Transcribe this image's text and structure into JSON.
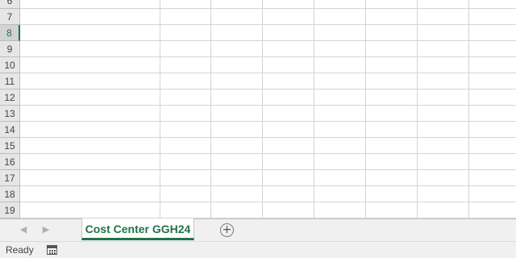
{
  "grid": {
    "rows": [
      {
        "label": "6"
      },
      {
        "label": "7"
      },
      {
        "label": "8",
        "selected": true
      },
      {
        "label": "9"
      },
      {
        "label": "10"
      },
      {
        "label": "11"
      },
      {
        "label": "12"
      },
      {
        "label": "13"
      },
      {
        "label": "14"
      },
      {
        "label": "15"
      },
      {
        "label": "16"
      },
      {
        "label": "17"
      },
      {
        "label": "18"
      },
      {
        "label": "19"
      }
    ]
  },
  "sheet_tabs": {
    "active_tab": "Cost Center GGH24",
    "prev_icon": "chevron-left-icon",
    "next_icon": "chevron-right-icon",
    "add_icon": "plus-circle-icon"
  },
  "status_bar": {
    "status": "Ready",
    "macro_icon": "macro-record-icon"
  },
  "colors": {
    "accent": "#217346",
    "gridline": "#d4d4d4",
    "header_bg": "#e6e6e6"
  }
}
